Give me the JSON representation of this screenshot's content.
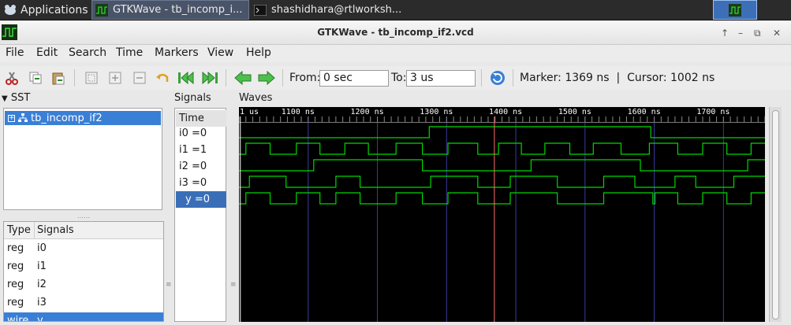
{
  "taskbar": {
    "applications_label": "Applications",
    "tasks": [
      {
        "label": "GTKWave - tb_incomp_i..."
      },
      {
        "label": "shashidhara@rtlworksh..."
      }
    ]
  },
  "window": {
    "title": "GTKWave - tb_incomp_if2.vcd"
  },
  "menu": [
    "File",
    "Edit",
    "Search",
    "Time",
    "Markers",
    "View",
    "Help"
  ],
  "toolbar": {
    "from_label": "From:",
    "from_value": "0 sec",
    "to_label": "To:",
    "to_value": "3 us",
    "marker_text": "Marker: 1369 ns  |  Cursor: 1002 ns",
    "icons": [
      "cut-icon",
      "copy-icon",
      "paste-icon",
      "zoom-fit-icon",
      "zoom-in-icon",
      "zoom-out-icon",
      "undo-icon",
      "zoom-start-icon",
      "zoom-end-icon",
      "prev-edge-icon",
      "next-edge-icon",
      "reload-icon"
    ]
  },
  "sst": {
    "title": "SST",
    "tree_item": "tb_incomp_if2"
  },
  "signals_table": {
    "col_type": "Type",
    "col_signals": "Signals",
    "rows": [
      {
        "type": "reg",
        "name": "i0"
      },
      {
        "type": "reg",
        "name": "i1"
      },
      {
        "type": "reg",
        "name": "i2"
      },
      {
        "type": "reg",
        "name": "i3"
      },
      {
        "type": "wire",
        "name": "y"
      }
    ]
  },
  "signals_panel": {
    "title": "Signals",
    "time_label": "Time",
    "rows": [
      "i0 =0",
      "i1 =1",
      "i2 =0",
      "i3 =0",
      "y =0"
    ]
  },
  "waves": {
    "title": "Waves",
    "tick_labels": [
      "1 us",
      "1100 ns",
      "1200 ns",
      "1300 ns",
      "1400 ns",
      "1500 ns",
      "1600 ns",
      "1700 ns"
    ],
    "view_start_ns": 1000,
    "view_end_ns": 1760,
    "marker_ns": 1369,
    "cursor_ns": 1002,
    "colors": {
      "background": "#000000",
      "trace": "#00d800",
      "grid": "#3a3aa0",
      "marker": "#ff7070",
      "text": "#ffffff"
    },
    "traces": [
      {
        "name": "i0",
        "initial": 0,
        "edges_ns": [
          1275,
          1595
        ]
      },
      {
        "name": "i1",
        "initial": 0,
        "edges_ns": [
          1010,
          1045,
          1083,
          1117,
          1153,
          1187,
          1227,
          1265,
          1302,
          1345,
          1375,
          1408,
          1442,
          1478,
          1512,
          1552,
          1593,
          1634,
          1670,
          1705,
          1740
        ]
      },
      {
        "name": "i2",
        "initial": 0,
        "edges_ns": [
          1108,
          1265,
          1422,
          1580,
          1735
        ]
      },
      {
        "name": "i3",
        "initial": 0,
        "edges_ns": [
          1015,
          1068,
          1140,
          1175,
          1277,
          1345,
          1392,
          1460,
          1527,
          1572,
          1630,
          1660,
          1715
        ]
      },
      {
        "name": "y",
        "initial": 0,
        "edges_ns": [
          1010,
          1045,
          1083,
          1117,
          1140,
          1175,
          1227,
          1265,
          1302,
          1345,
          1392,
          1460,
          1527,
          1598,
          1601,
          1634,
          1670,
          1705,
          1740
        ]
      }
    ]
  }
}
